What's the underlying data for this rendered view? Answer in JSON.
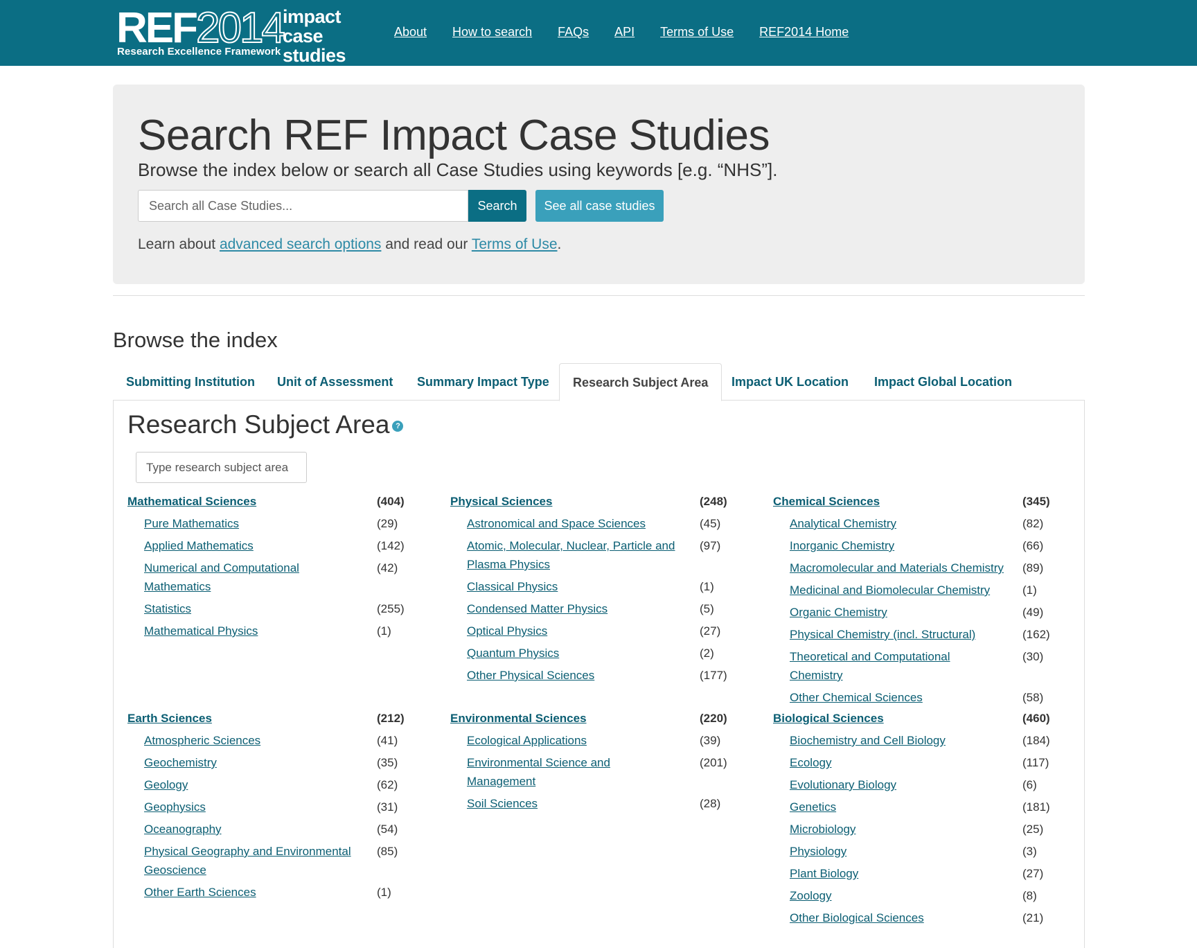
{
  "header": {
    "logo_ref_bold": "REF",
    "logo_ref_year": "2014",
    "logo_impact_line1": "impact",
    "logo_impact_line2": "case studies",
    "logo_sub": "Research Excellence Framework",
    "nav": [
      "About",
      "How to search",
      "FAQs",
      "API",
      "Terms of Use",
      "REF2014 Home"
    ],
    "bg_color": "#0b6e84"
  },
  "hero": {
    "title": "Search REF Impact Case Studies",
    "lead": "Browse the index below or search all Case Studies using keywords [e.g. “NHS”].",
    "search_placeholder": "Search all Case Studies...",
    "search_button": "Search",
    "see_all_button": "See all case studies",
    "learn_prefix": "Learn about ",
    "learn_link1": "advanced search options",
    "learn_mid": " and read our ",
    "learn_link2": "Terms of Use",
    "learn_suffix": "."
  },
  "browse": {
    "title": "Browse the index",
    "tabs": [
      "Submitting Institution",
      "Unit of Assessment",
      "Summary Impact Type",
      "Research Subject Area",
      "Impact UK Location",
      "Impact Global Location"
    ],
    "active_tab": "Research Subject Area",
    "panel_title": "Research Subject Area",
    "help_icon": "?",
    "filter_placeholder": "Type research subject area",
    "groups": [
      {
        "name": "Mathematical Sciences",
        "count": "(404)",
        "items": [
          {
            "name": "Pure Mathematics",
            "count": "(29)"
          },
          {
            "name": "Applied Mathematics",
            "count": "(142)"
          },
          {
            "name": "Numerical and Computational Mathematics",
            "count": "(42)"
          },
          {
            "name": "Statistics",
            "count": "(255)"
          },
          {
            "name": "Mathematical Physics",
            "count": "(1)"
          }
        ]
      },
      {
        "name": "Physical Sciences",
        "count": "(248)",
        "items": [
          {
            "name": "Astronomical and Space Sciences",
            "count": "(45)"
          },
          {
            "name": "Atomic, Molecular, Nuclear, Particle and Plasma Physics",
            "count": "(97)"
          },
          {
            "name": "Classical Physics",
            "count": "(1)"
          },
          {
            "name": "Condensed Matter Physics",
            "count": "(5)"
          },
          {
            "name": "Optical Physics",
            "count": "(27)"
          },
          {
            "name": "Quantum Physics",
            "count": "(2)"
          },
          {
            "name": "Other Physical Sciences",
            "count": "(177)"
          }
        ]
      },
      {
        "name": "Chemical Sciences",
        "count": "(345)",
        "items": [
          {
            "name": "Analytical Chemistry",
            "count": "(82)"
          },
          {
            "name": "Inorganic Chemistry",
            "count": "(66)"
          },
          {
            "name": "Macromolecular and Materials Chemistry",
            "count": "(89)"
          },
          {
            "name": "Medicinal and Biomolecular Chemistry",
            "count": "(1)"
          },
          {
            "name": "Organic Chemistry",
            "count": "(49)"
          },
          {
            "name": "Physical Chemistry (incl. Structural)",
            "count": "(162)"
          },
          {
            "name": "Theoretical and Computational Chemistry",
            "count": "(30)"
          },
          {
            "name": "Other Chemical Sciences",
            "count": "(58)"
          }
        ]
      },
      {
        "name": "Earth Sciences",
        "count": "(212)",
        "items": [
          {
            "name": "Atmospheric Sciences",
            "count": "(41)"
          },
          {
            "name": "Geochemistry",
            "count": "(35)"
          },
          {
            "name": "Geology",
            "count": "(62)"
          },
          {
            "name": "Geophysics",
            "count": "(31)"
          },
          {
            "name": "Oceanography",
            "count": "(54)"
          },
          {
            "name": "Physical Geography and Environmental Geoscience",
            "count": "(85)"
          },
          {
            "name": "Other Earth Sciences",
            "count": "(1)"
          }
        ]
      },
      {
        "name": "Environmental Sciences",
        "count": "(220)",
        "items": [
          {
            "name": "Ecological Applications",
            "count": "(39)"
          },
          {
            "name": "Environmental Science and Management",
            "count": "(201)"
          },
          {
            "name": "Soil Sciences",
            "count": "(28)"
          }
        ]
      },
      {
        "name": "Biological Sciences",
        "count": "(460)",
        "items": [
          {
            "name": "Biochemistry and Cell Biology",
            "count": "(184)"
          },
          {
            "name": "Ecology",
            "count": "(117)"
          },
          {
            "name": "Evolutionary Biology",
            "count": "(6)"
          },
          {
            "name": "Genetics",
            "count": "(181)"
          },
          {
            "name": "Microbiology",
            "count": "(25)"
          },
          {
            "name": "Physiology",
            "count": "(3)"
          },
          {
            "name": "Plant Biology",
            "count": "(27)"
          },
          {
            "name": "Zoology",
            "count": "(8)"
          },
          {
            "name": "Other Biological Sciences",
            "count": "(21)"
          }
        ]
      }
    ]
  }
}
